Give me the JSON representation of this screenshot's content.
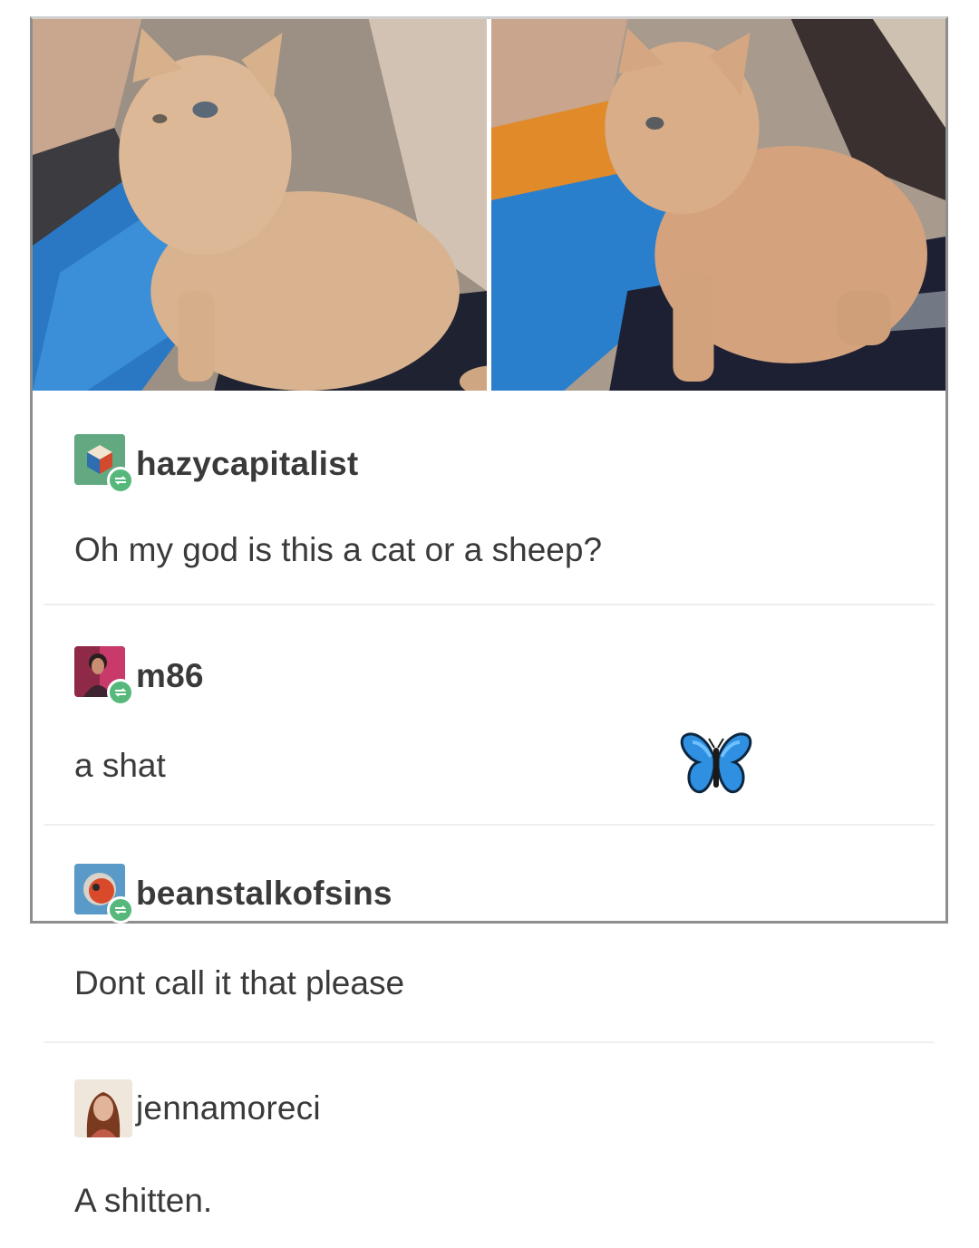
{
  "posts": [
    {
      "username": "hazycapitalist",
      "text": "Oh my god is this a cat or a sheep?",
      "avatar_icon": "cube-avatar-icon"
    },
    {
      "username": "m86",
      "text": "a shat",
      "avatar_icon": "person-photo-avatar"
    },
    {
      "username": "beanstalkofsins",
      "text": "Dont call it that please",
      "avatar_icon": "circle-avatar-icon"
    },
    {
      "username": "jennamoreci",
      "text": "A shitten.",
      "avatar_icon": "woman-photo-avatar"
    }
  ],
  "decoration": {
    "sticker": "butterfly-emoji"
  },
  "colors": {
    "reblog_badge": "#56b87a",
    "text": "#3a3a3a",
    "border": "#8e8e8e"
  }
}
